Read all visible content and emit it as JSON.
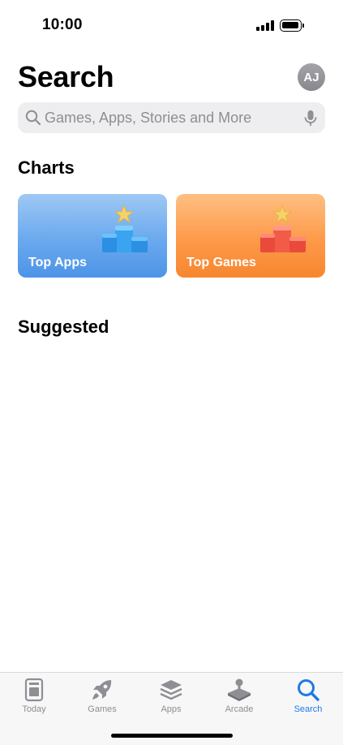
{
  "status_bar": {
    "time": "10:00"
  },
  "header": {
    "title": "Search",
    "avatar_initials": "AJ"
  },
  "search": {
    "placeholder": "Games, Apps, Stories and More"
  },
  "charts": {
    "title": "Charts",
    "cards": [
      {
        "label": "Top Apps",
        "color": "#5a9fea"
      },
      {
        "label": "Top Games",
        "color": "#fb9442"
      }
    ]
  },
  "suggested": {
    "title": "Suggested"
  },
  "tab_bar": {
    "accent": "#1d7ae8",
    "items": [
      {
        "label": "Today",
        "icon": "today-icon"
      },
      {
        "label": "Games",
        "icon": "rocket-icon"
      },
      {
        "label": "Apps",
        "icon": "stack-icon"
      },
      {
        "label": "Arcade",
        "icon": "joystick-icon"
      },
      {
        "label": "Search",
        "icon": "search-icon",
        "active": true
      }
    ]
  }
}
